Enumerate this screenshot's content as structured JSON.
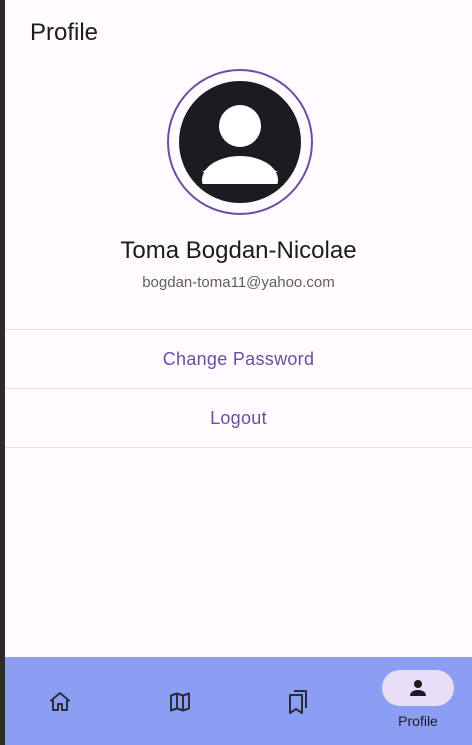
{
  "header": {
    "title": "Profile"
  },
  "profile": {
    "avatar_icon": "account-circle-icon",
    "name": "Toma Bogdan-Nicolae",
    "email": "bogdan-toma11@yahoo.com"
  },
  "actions": {
    "change_password": "Change Password",
    "logout": "Logout"
  },
  "bottom_nav": {
    "items": [
      {
        "icon": "home-icon",
        "label": ""
      },
      {
        "icon": "map-icon",
        "label": ""
      },
      {
        "icon": "bookmarks-icon",
        "label": ""
      },
      {
        "icon": "person-icon",
        "label": "Profile",
        "active": true
      }
    ]
  },
  "colors": {
    "accent": "#6750a4",
    "nav_background": "#8c9ef3",
    "active_pill": "#e8def8",
    "surface": "#fffbfe",
    "text": "#1c1b1f"
  }
}
